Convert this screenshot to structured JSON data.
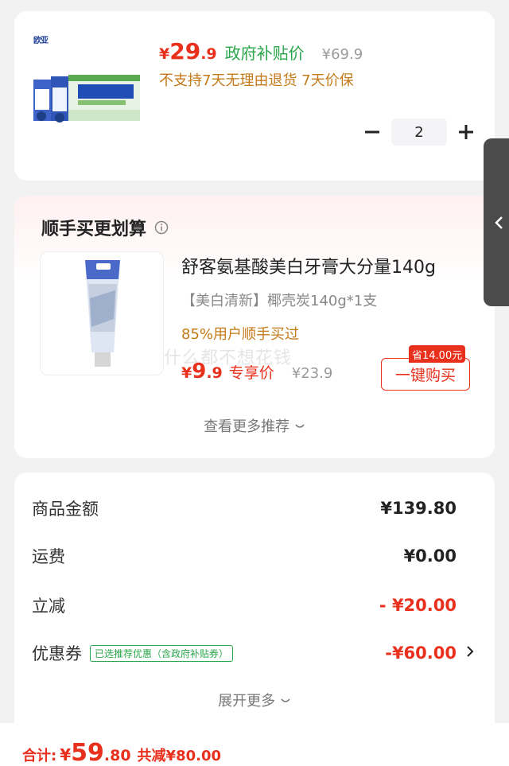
{
  "product": {
    "logo_text": "欧亚",
    "image_alt": "欧亚纯牛奶",
    "price_symbol": "¥",
    "price_int": "29",
    "price_dec": ".9",
    "gov_label": "政府补贴价",
    "orig_price": "¥69.9",
    "policy": "不支持7天无理由退货 7天价保",
    "quantity": "2"
  },
  "recommend": {
    "title": "顺手买更划算",
    "name": "舒客氨基酸美白牙膏大分量140g",
    "spec": "【美白清新】椰壳炭140g*1支",
    "buyers": "85%用户顺手买过",
    "price_symbol": "¥",
    "price_int": "9",
    "price_dec": ".9",
    "exclusive_label": "专享价",
    "orig_price": "¥23.9",
    "save_badge": "省14.00元",
    "buy_label": "一键购买",
    "more_label": "查看更多推荐",
    "watermark": "什么都不想花钱"
  },
  "summary": {
    "rows": [
      {
        "label": "商品金额",
        "value": "¥139.80"
      },
      {
        "label": "运费",
        "value": "¥0.00"
      },
      {
        "label": "立减",
        "value": "- ¥20.00"
      },
      {
        "label": "优惠券",
        "value": "-¥60.00"
      }
    ],
    "coupon_tag": "已选推荐优惠（含政府补贴券）",
    "expand_label": "展开更多"
  },
  "bottom": {
    "total_label": "合计:",
    "total_yen": "¥",
    "total_int": "59",
    "total_dec": ".80",
    "total_save": "共减¥80.00"
  },
  "colors": {
    "accent_red": "#e9301c",
    "gov_green": "#2aa64a",
    "policy_orange": "#c47a18"
  }
}
